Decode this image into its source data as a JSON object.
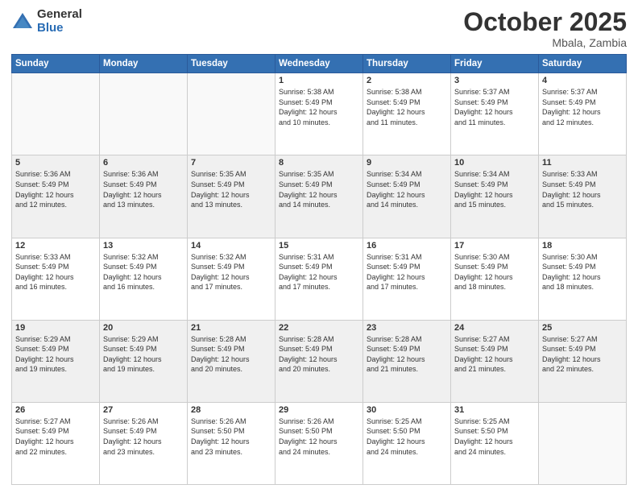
{
  "header": {
    "logo_general": "General",
    "logo_blue": "Blue",
    "month_title": "October 2025",
    "location": "Mbala, Zambia"
  },
  "weekdays": [
    "Sunday",
    "Monday",
    "Tuesday",
    "Wednesday",
    "Thursday",
    "Friday",
    "Saturday"
  ],
  "weeks": [
    [
      {
        "day": "",
        "info": ""
      },
      {
        "day": "",
        "info": ""
      },
      {
        "day": "",
        "info": ""
      },
      {
        "day": "1",
        "info": "Sunrise: 5:38 AM\nSunset: 5:49 PM\nDaylight: 12 hours\nand 10 minutes."
      },
      {
        "day": "2",
        "info": "Sunrise: 5:38 AM\nSunset: 5:49 PM\nDaylight: 12 hours\nand 11 minutes."
      },
      {
        "day": "3",
        "info": "Sunrise: 5:37 AM\nSunset: 5:49 PM\nDaylight: 12 hours\nand 11 minutes."
      },
      {
        "day": "4",
        "info": "Sunrise: 5:37 AM\nSunset: 5:49 PM\nDaylight: 12 hours\nand 12 minutes."
      }
    ],
    [
      {
        "day": "5",
        "info": "Sunrise: 5:36 AM\nSunset: 5:49 PM\nDaylight: 12 hours\nand 12 minutes."
      },
      {
        "day": "6",
        "info": "Sunrise: 5:36 AM\nSunset: 5:49 PM\nDaylight: 12 hours\nand 13 minutes."
      },
      {
        "day": "7",
        "info": "Sunrise: 5:35 AM\nSunset: 5:49 PM\nDaylight: 12 hours\nand 13 minutes."
      },
      {
        "day": "8",
        "info": "Sunrise: 5:35 AM\nSunset: 5:49 PM\nDaylight: 12 hours\nand 14 minutes."
      },
      {
        "day": "9",
        "info": "Sunrise: 5:34 AM\nSunset: 5:49 PM\nDaylight: 12 hours\nand 14 minutes."
      },
      {
        "day": "10",
        "info": "Sunrise: 5:34 AM\nSunset: 5:49 PM\nDaylight: 12 hours\nand 15 minutes."
      },
      {
        "day": "11",
        "info": "Sunrise: 5:33 AM\nSunset: 5:49 PM\nDaylight: 12 hours\nand 15 minutes."
      }
    ],
    [
      {
        "day": "12",
        "info": "Sunrise: 5:33 AM\nSunset: 5:49 PM\nDaylight: 12 hours\nand 16 minutes."
      },
      {
        "day": "13",
        "info": "Sunrise: 5:32 AM\nSunset: 5:49 PM\nDaylight: 12 hours\nand 16 minutes."
      },
      {
        "day": "14",
        "info": "Sunrise: 5:32 AM\nSunset: 5:49 PM\nDaylight: 12 hours\nand 17 minutes."
      },
      {
        "day": "15",
        "info": "Sunrise: 5:31 AM\nSunset: 5:49 PM\nDaylight: 12 hours\nand 17 minutes."
      },
      {
        "day": "16",
        "info": "Sunrise: 5:31 AM\nSunset: 5:49 PM\nDaylight: 12 hours\nand 17 minutes."
      },
      {
        "day": "17",
        "info": "Sunrise: 5:30 AM\nSunset: 5:49 PM\nDaylight: 12 hours\nand 18 minutes."
      },
      {
        "day": "18",
        "info": "Sunrise: 5:30 AM\nSunset: 5:49 PM\nDaylight: 12 hours\nand 18 minutes."
      }
    ],
    [
      {
        "day": "19",
        "info": "Sunrise: 5:29 AM\nSunset: 5:49 PM\nDaylight: 12 hours\nand 19 minutes."
      },
      {
        "day": "20",
        "info": "Sunrise: 5:29 AM\nSunset: 5:49 PM\nDaylight: 12 hours\nand 19 minutes."
      },
      {
        "day": "21",
        "info": "Sunrise: 5:28 AM\nSunset: 5:49 PM\nDaylight: 12 hours\nand 20 minutes."
      },
      {
        "day": "22",
        "info": "Sunrise: 5:28 AM\nSunset: 5:49 PM\nDaylight: 12 hours\nand 20 minutes."
      },
      {
        "day": "23",
        "info": "Sunrise: 5:28 AM\nSunset: 5:49 PM\nDaylight: 12 hours\nand 21 minutes."
      },
      {
        "day": "24",
        "info": "Sunrise: 5:27 AM\nSunset: 5:49 PM\nDaylight: 12 hours\nand 21 minutes."
      },
      {
        "day": "25",
        "info": "Sunrise: 5:27 AM\nSunset: 5:49 PM\nDaylight: 12 hours\nand 22 minutes."
      }
    ],
    [
      {
        "day": "26",
        "info": "Sunrise: 5:27 AM\nSunset: 5:49 PM\nDaylight: 12 hours\nand 22 minutes."
      },
      {
        "day": "27",
        "info": "Sunrise: 5:26 AM\nSunset: 5:49 PM\nDaylight: 12 hours\nand 23 minutes."
      },
      {
        "day": "28",
        "info": "Sunrise: 5:26 AM\nSunset: 5:50 PM\nDaylight: 12 hours\nand 23 minutes."
      },
      {
        "day": "29",
        "info": "Sunrise: 5:26 AM\nSunset: 5:50 PM\nDaylight: 12 hours\nand 24 minutes."
      },
      {
        "day": "30",
        "info": "Sunrise: 5:25 AM\nSunset: 5:50 PM\nDaylight: 12 hours\nand 24 minutes."
      },
      {
        "day": "31",
        "info": "Sunrise: 5:25 AM\nSunset: 5:50 PM\nDaylight: 12 hours\nand 24 minutes."
      },
      {
        "day": "",
        "info": ""
      }
    ]
  ]
}
